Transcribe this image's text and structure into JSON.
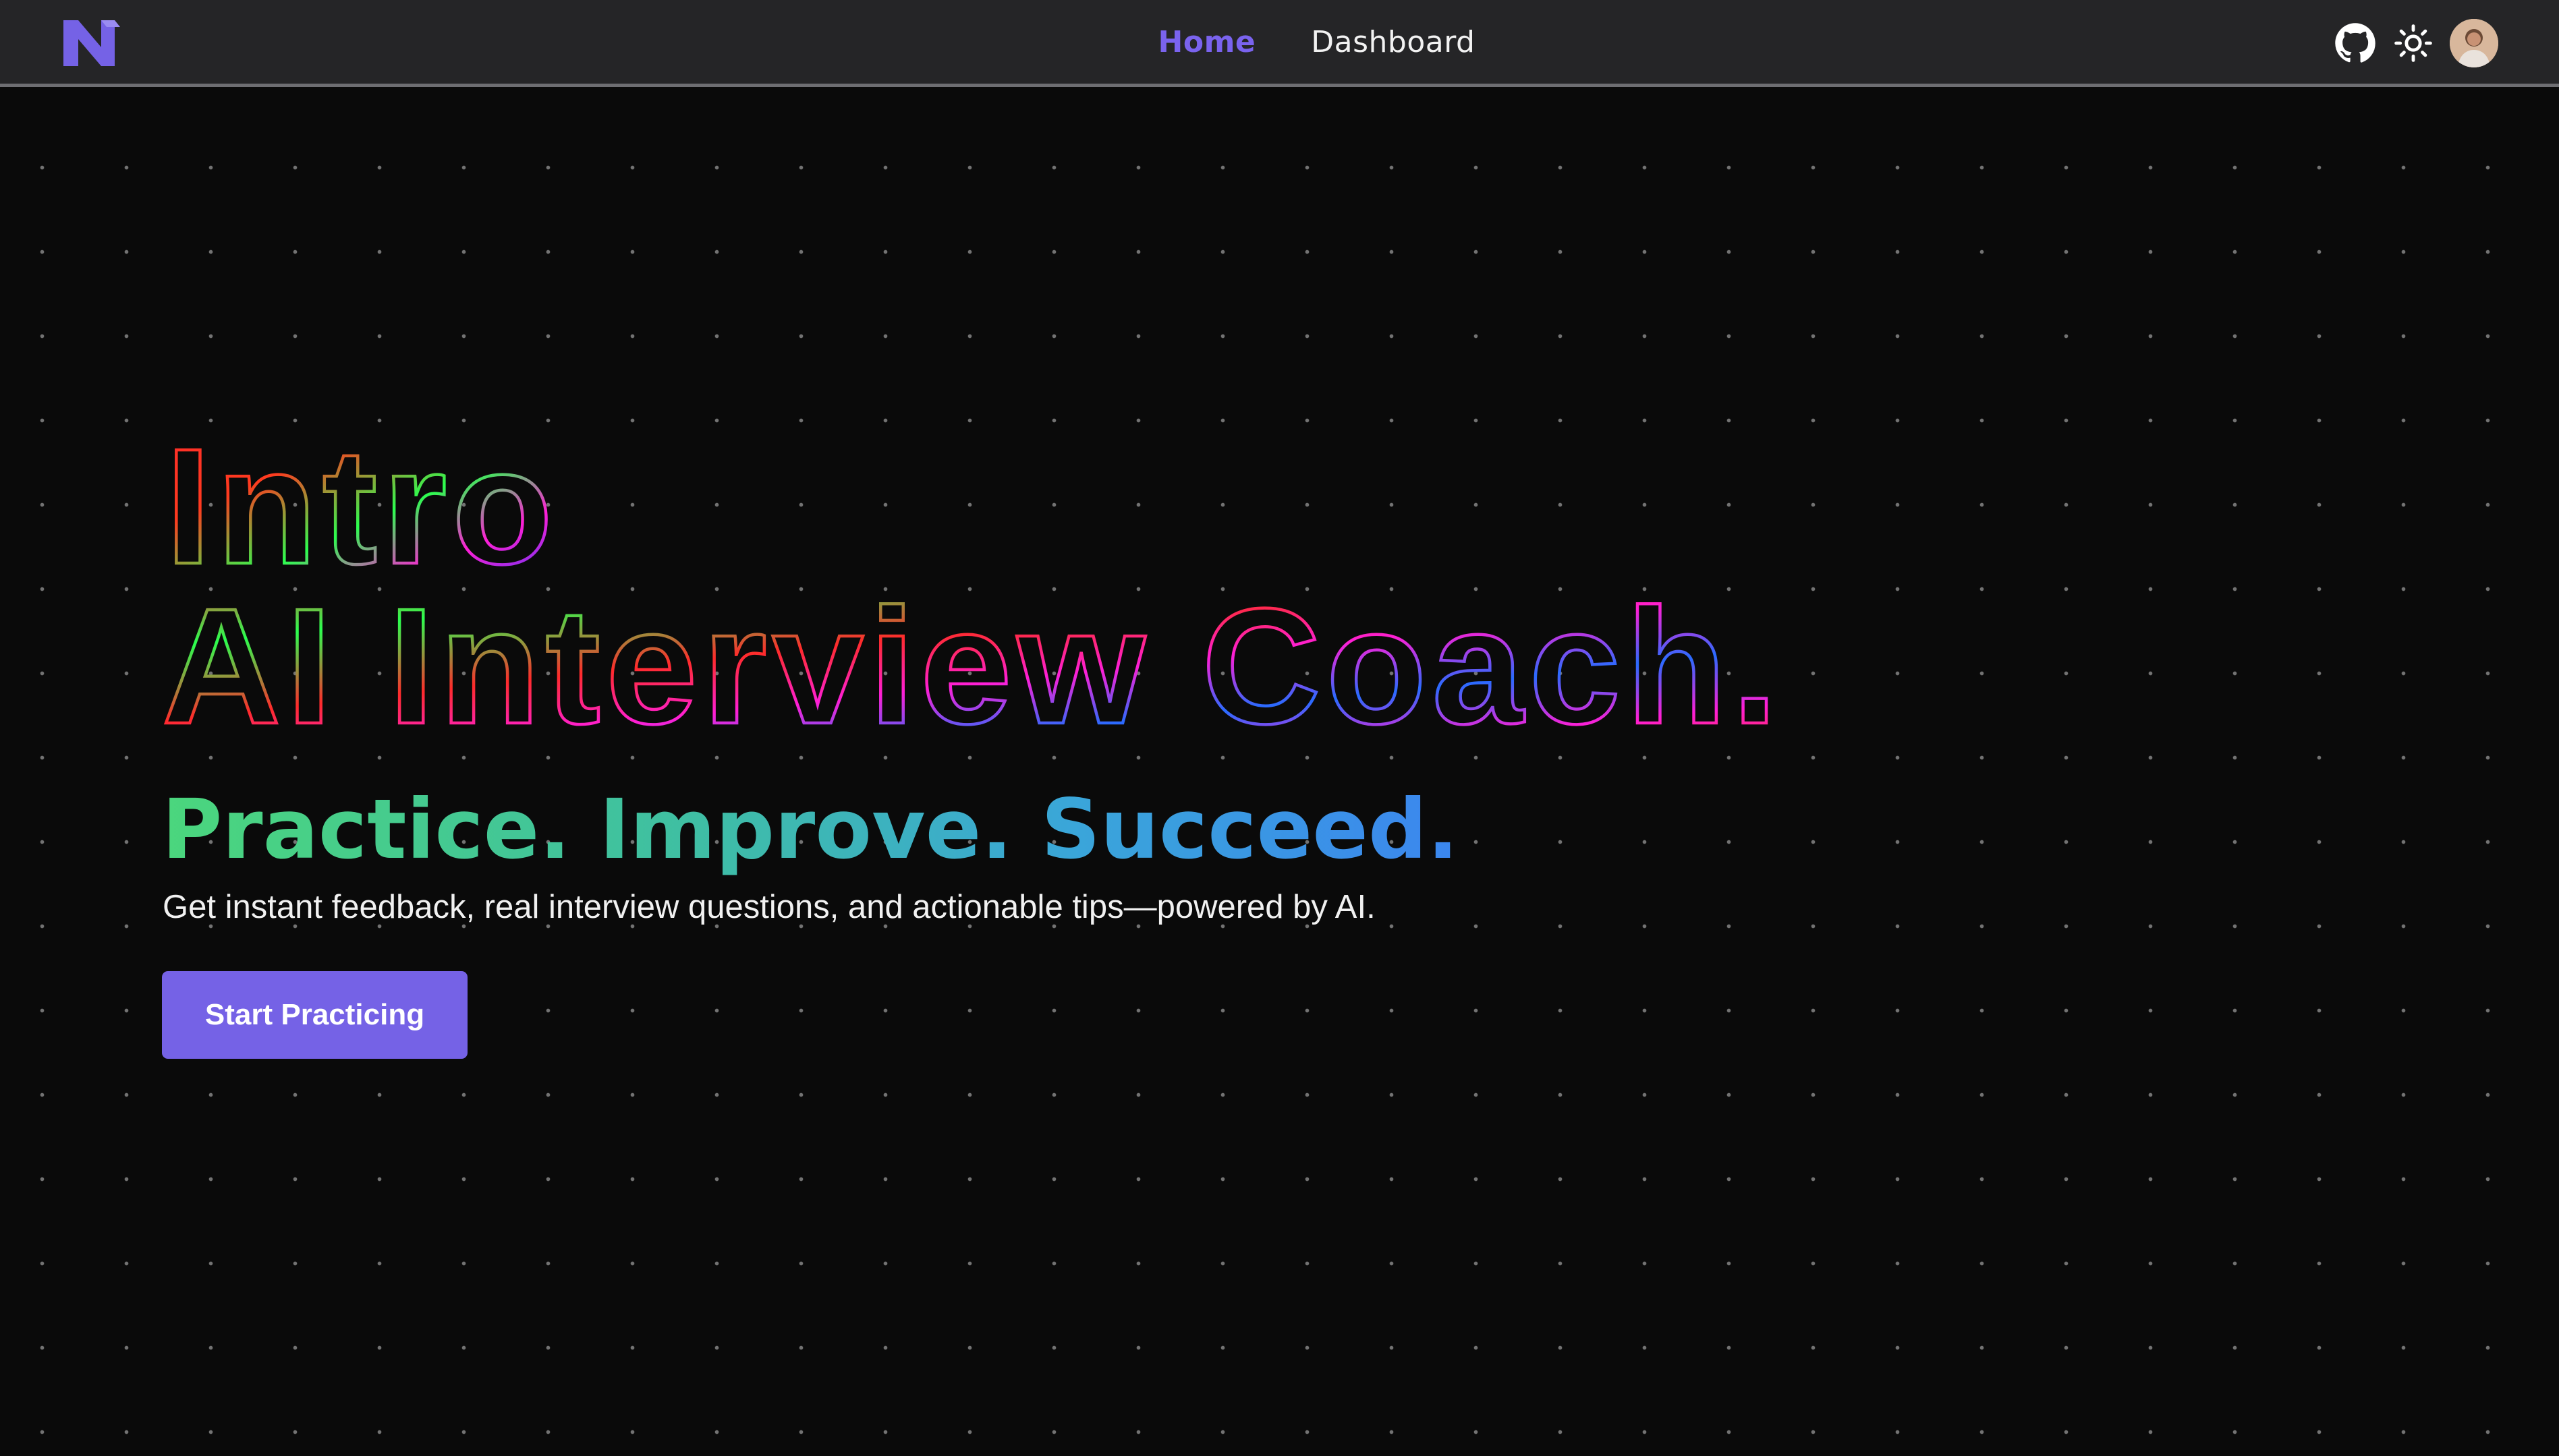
{
  "navbar": {
    "logo_icon": "n-logo-icon",
    "links": [
      {
        "label": "Home",
        "active": true
      },
      {
        "label": "Dashboard",
        "active": false
      }
    ],
    "icons": [
      "github-icon",
      "sun-icon",
      "avatar"
    ]
  },
  "hero": {
    "title_line1": "Intro",
    "title_line2": "AI Interview Coach.",
    "tagline": "Practice. Improve. Succeed.",
    "subtitle": "Get instant feedback, real interview questions, and actionable tips—powered by AI.",
    "cta_label": "Start Practicing"
  },
  "colors": {
    "accent": "#7562e6",
    "nav_active": "#7a63ee",
    "navbar_bg": "#252527",
    "page_bg": "#0a0a0a",
    "outline_gradient": [
      "#ff2b2b",
      "#2bff4e",
      "#ff1fd6",
      "#2a3bff"
    ],
    "tagline_gradient": [
      "#4bd67d",
      "#3fbfa2",
      "#3aa6d9",
      "#3b86ef"
    ]
  }
}
